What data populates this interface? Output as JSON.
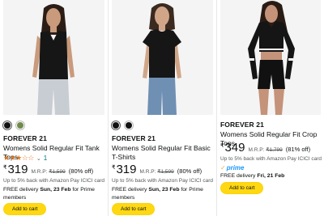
{
  "products": [
    {
      "brand": "",
      "title": "Womens Solid Regular Fit Tank Tops",
      "swatches": [
        "#111111",
        "#6e8b4a"
      ],
      "rating": {
        "stars": "★★★☆☆",
        "count": "1"
      },
      "currency": "₹",
      "price": "319",
      "mrp_label": "M.R.P:",
      "mrp": "₹1,599",
      "discount": "(80% off)",
      "cashback": "Up to 5% back with Amazon Pay ICICI card",
      "delivery_prefix": "FREE delivery ",
      "delivery_date": "Sun, 23 Feb",
      "delivery_suffix": " for Prime members",
      "button": "Add to cart",
      "image_icon": "model-black-tank-top"
    },
    {
      "brand": "",
      "title": "Womens Solid Regular Fit Basic T-Shirts",
      "swatches": [
        "#111111",
        "#111111"
      ],
      "currency": "₹",
      "price": "319",
      "mrp_label": "M.R.P:",
      "mrp": "₹1,599",
      "discount": "(80% off)",
      "cashback": "Up to 5% back with Amazon Pay ICICI card",
      "delivery_prefix": "FREE delivery ",
      "delivery_date": "Sun, 23 Feb",
      "delivery_suffix": " for Prime members",
      "button": "Add to cart",
      "image_icon": "model-black-tshirt"
    },
    {
      "brand": "FOREVER 21",
      "title": "Womens Solid Regular Fit Crop Tops",
      "currency": "₹",
      "price": "349",
      "mrp_label": "M.R.P:",
      "mrp": "₹1,799",
      "discount": "(81% off)",
      "cashback": "Up to 5% back with Amazon Pay ICICI card",
      "prime": "prime",
      "delivery_prefix": "FREE delivery ",
      "delivery_date": "Fri, 21 Feb",
      "delivery_suffix": "",
      "button": "Add to cart",
      "image_icon": "model-black-crop-top"
    }
  ],
  "brand_shared": "FOREVER 21",
  "colors": {
    "add_to_cart": "#ffd814",
    "rating_star": "#de7921",
    "link": "#007185",
    "prime_blue": "#1a98ff"
  }
}
